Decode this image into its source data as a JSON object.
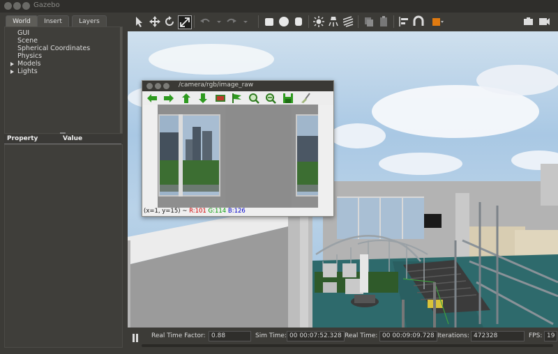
{
  "app": {
    "title": "Gazebo"
  },
  "left_panel": {
    "tabs": [
      {
        "label": "World"
      },
      {
        "label": "Insert"
      },
      {
        "label": "Layers"
      }
    ],
    "tree": [
      {
        "label": "GUI",
        "expandable": false
      },
      {
        "label": "Scene",
        "expandable": false
      },
      {
        "label": "Spherical Coordinates",
        "expandable": false
      },
      {
        "label": "Physics",
        "expandable": false
      },
      {
        "label": "Models",
        "expandable": true
      },
      {
        "label": "Lights",
        "expandable": true
      }
    ],
    "property_header": {
      "property": "Property",
      "value": "Value"
    }
  },
  "toolbar": {
    "tools": [
      "select-arrow-icon",
      "translate-icon",
      "rotate-icon",
      "scale-icon",
      "undo-icon",
      "redo-icon",
      "box-shape-icon",
      "sphere-shape-icon",
      "cylinder-shape-icon",
      "point-light-icon",
      "spot-light-icon",
      "directional-light-icon",
      "copy-icon",
      "paste-icon",
      "align-icon",
      "snap-icon",
      "color-view-icon",
      "screenshot-icon",
      "record-icon"
    ]
  },
  "image_window": {
    "title": "/camera/rgb/image_raw",
    "coords": {
      "xy": "(x=1, y=15) ~",
      "r": "R:101",
      "g": "G:114",
      "b": "B:126"
    },
    "tools": [
      "back-arrow-icon",
      "forward-arrow-icon",
      "up-arrow-icon",
      "down-arrow-icon",
      "image-icon",
      "flag-icon",
      "zoom-in-icon",
      "zoom-out-icon",
      "save-icon",
      "brush-icon"
    ]
  },
  "statusbar": {
    "real_time_factor": {
      "label": "Real Time Factor:",
      "value": "0.88"
    },
    "sim_time": {
      "label": "Sim Time:",
      "value": "00 00:07:52.328"
    },
    "real_time": {
      "label": "Real Time:",
      "value": "00 00:09:09.728"
    },
    "iterations": {
      "label": "Iterations:",
      "value": "472328"
    },
    "fps": {
      "label": "FPS:",
      "value": "19"
    }
  },
  "colors": {
    "background": "#3c3b37",
    "floor": "#2e6a6c",
    "sky": "#a9c8e4",
    "green_arrow": "#2e9a1f"
  }
}
